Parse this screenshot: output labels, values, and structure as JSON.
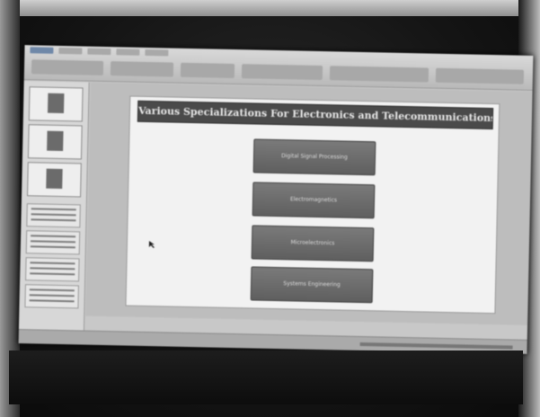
{
  "presentation": {
    "slide_title": "Various Specializations For Electronics and Telecommunications",
    "specializations": [
      "Digital Signal Processing",
      "Electromagnetics",
      "Microelectronics",
      "Systems Engineering"
    ]
  },
  "sidebar": {
    "slide_thumbnail_count": 3,
    "outline_thumbnail_count": 4
  },
  "colors": {
    "title_bar": "#4a4a4a",
    "box_fill": "#6b6b6b",
    "slide_bg": "#f2f2f2",
    "ribbon": "#c9c9c9"
  },
  "icons": [
    "file-tab-icon",
    "slide-thumbnail-icon",
    "cursor-icon"
  ]
}
